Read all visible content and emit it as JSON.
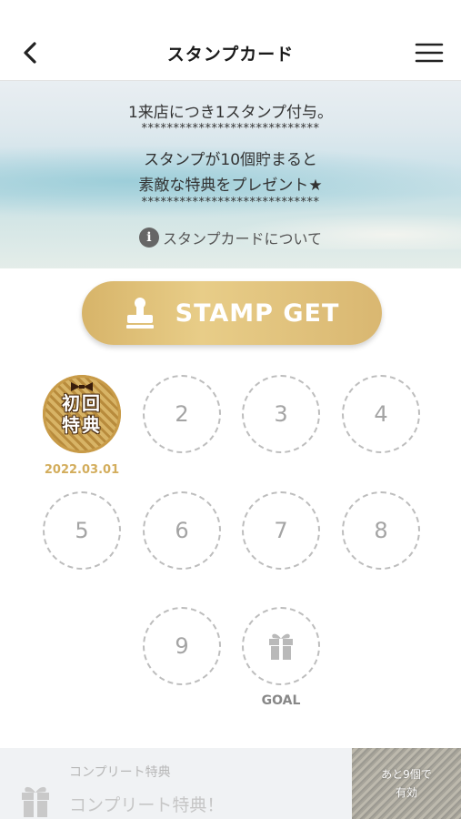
{
  "header": {
    "title": "スタンプカード"
  },
  "banner": {
    "line1": "1来店につき1スタンプ付与。",
    "stars": "****************************",
    "line2": "スタンプが10個貯まると",
    "line3": "素敵な特典をプレゼント★",
    "stars2": "****************************",
    "about_label": "スタンプカードについて"
  },
  "stamp_button": {
    "label": "STAMP GET"
  },
  "first_stamp": {
    "line1": "初回",
    "line2": "特典",
    "date": "2022.03.01"
  },
  "slots": [
    "2",
    "3",
    "4",
    "5",
    "6",
    "7",
    "8",
    "9"
  ],
  "goal": {
    "label": "GOAL"
  },
  "complete": {
    "small_label": "コンプリート特典",
    "big_label": "コンプリート特典！",
    "remain_line1": "あと9個で",
    "remain_line2": "有効"
  },
  "colors": {
    "accent_gold": "#d9b771",
    "date_gold": "#d3ad5c",
    "slot_border": "#bdbdbd"
  }
}
